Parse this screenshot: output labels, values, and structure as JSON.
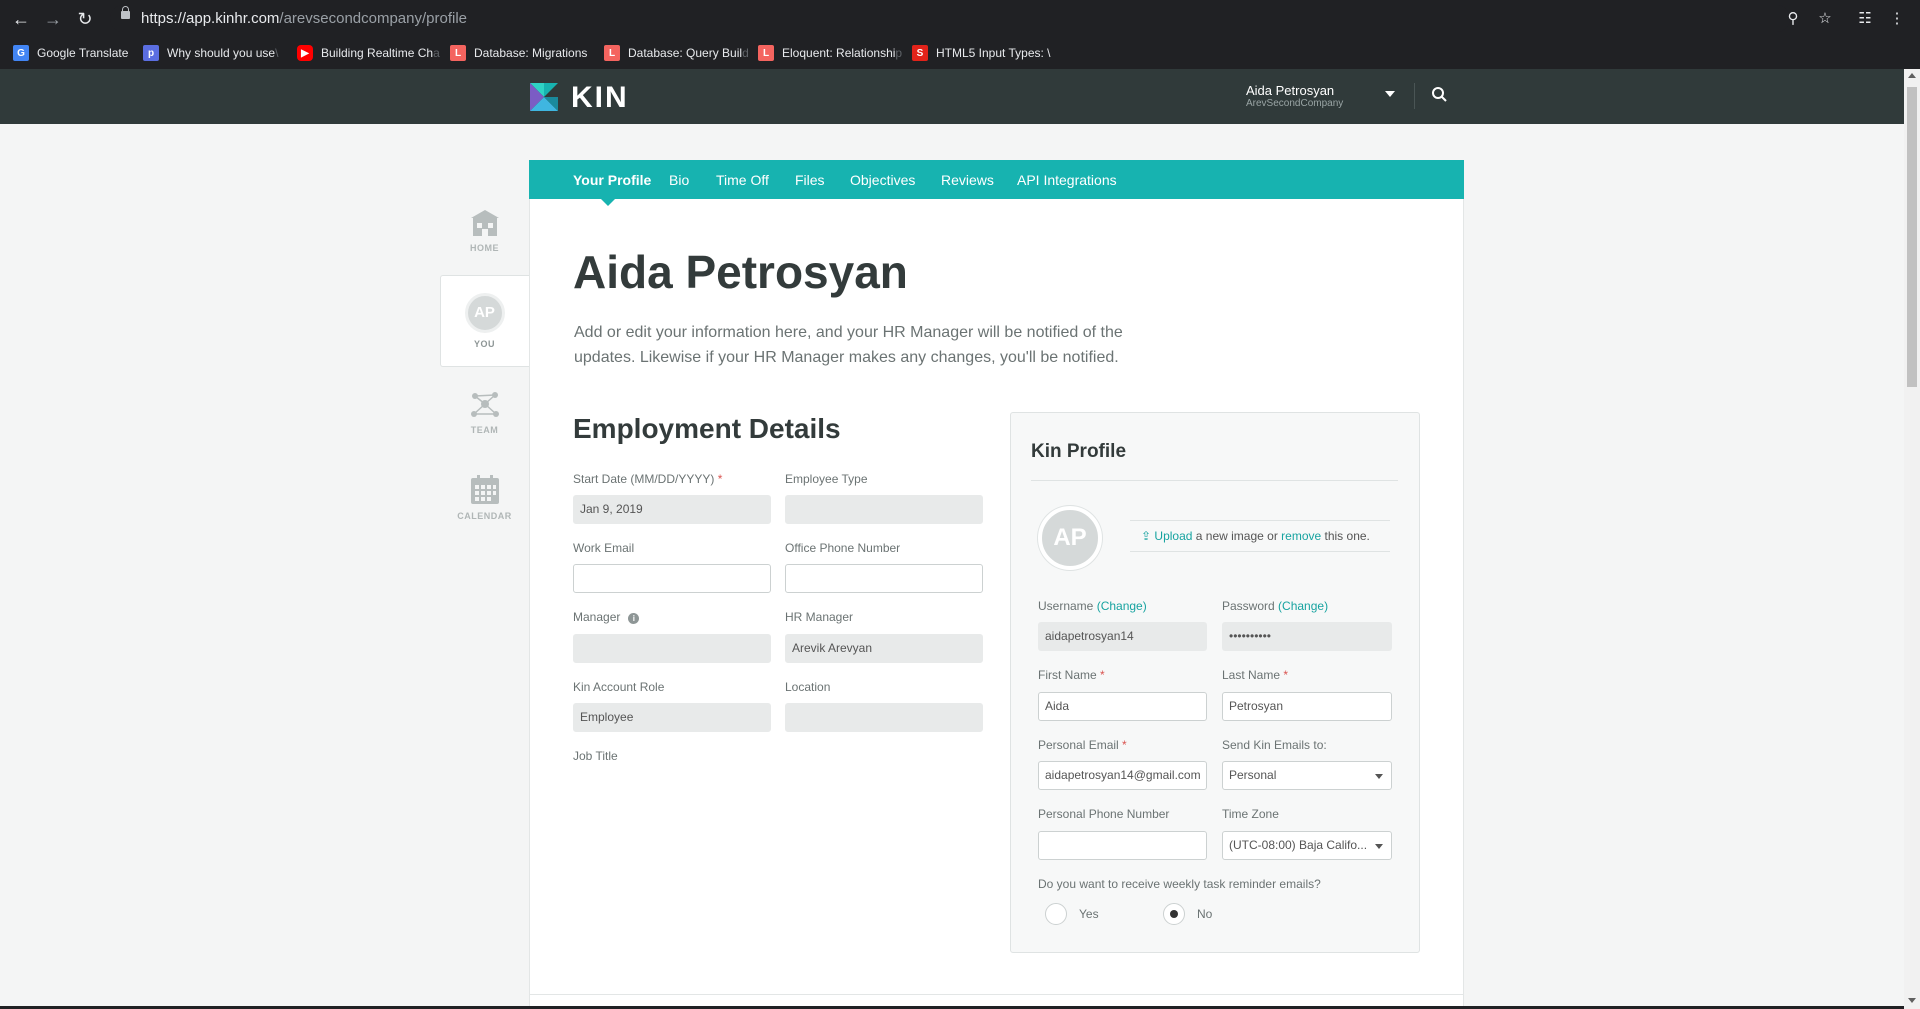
{
  "browser": {
    "url_host": "https://app.kinhr.com",
    "url_path": "/arevsecondcompany/profile",
    "bookmarks": [
      {
        "label": "Google Translate",
        "fade": ""
      },
      {
        "label": "Why should you use",
        "fade": " \\"
      },
      {
        "label": "Building Realtime Ch",
        "fade": "a"
      },
      {
        "label": "Database: Migrations",
        "fade": ""
      },
      {
        "label": "Database: Query Buil",
        "fade": "d"
      },
      {
        "label": "Eloquent: Relationshi",
        "fade": "p"
      },
      {
        "label": "HTML5 Input Types: \\",
        "fade": ""
      }
    ]
  },
  "header": {
    "brand": "KIN",
    "user_name": "Aida Petrosyan",
    "company": "ArevSecondCompany"
  },
  "rail": {
    "home": "HOME",
    "you": "YOU",
    "you_initials": "AP",
    "team": "TEAM",
    "calendar": "CALENDAR"
  },
  "tabs": [
    "Your Profile",
    "Bio",
    "Time Off",
    "Files",
    "Objectives",
    "Reviews",
    "API Integrations"
  ],
  "profile": {
    "title": "Aida Petrosyan",
    "intro": "Add or edit your information here, and your HR Manager will be notified of the updates. Likewise if your HR Manager makes any changes, you'll be notified."
  },
  "employment": {
    "title": "Employment Details",
    "start_date_label": "Start Date (MM/DD/YYYY)",
    "start_date_value": "Jan 9, 2019",
    "employee_type_label": "Employee Type",
    "employee_type_value": "",
    "work_email_label": "Work Email",
    "work_email_value": "",
    "office_phone_label": "Office Phone Number",
    "office_phone_value": "",
    "manager_label": "Manager",
    "manager_value": "",
    "hr_manager_label": "HR Manager",
    "hr_manager_value": "Arevik Arevyan",
    "role_label": "Kin Account Role",
    "role_value": "Employee",
    "location_label": "Location",
    "location_value": "",
    "job_title_label": "Job Title"
  },
  "kin_profile": {
    "title": "Kin Profile",
    "initials": "AP",
    "upload_link": "Upload",
    "upload_mid": " a new image or ",
    "remove_link": "remove",
    "upload_end": " this one.",
    "username_label": "Username",
    "change": "(Change)",
    "username_value": "aidapetrosyan14",
    "password_label": "Password",
    "password_value": "••••••••••",
    "first_name_label": "First Name",
    "first_name_value": "Aida",
    "last_name_label": "Last Name",
    "last_name_value": "Petrosyan",
    "personal_email_label": "Personal Email",
    "personal_email_value": "aidapetrosyan14@gmail.com",
    "send_emails_label": "Send Kin Emails to:",
    "send_emails_value": "Personal",
    "phone_label": "Personal Phone Number",
    "phone_value": "",
    "timezone_label": "Time Zone",
    "timezone_value": "(UTC-08:00) Baja Califo...",
    "reminder_question": "Do you want to receive weekly task reminder emails?",
    "yes": "Yes",
    "no": "No",
    "reminder_selected": "No"
  },
  "colors": {
    "teal": "#17b3b0",
    "header_bg": "#303a3a",
    "required": "#d9534f"
  }
}
